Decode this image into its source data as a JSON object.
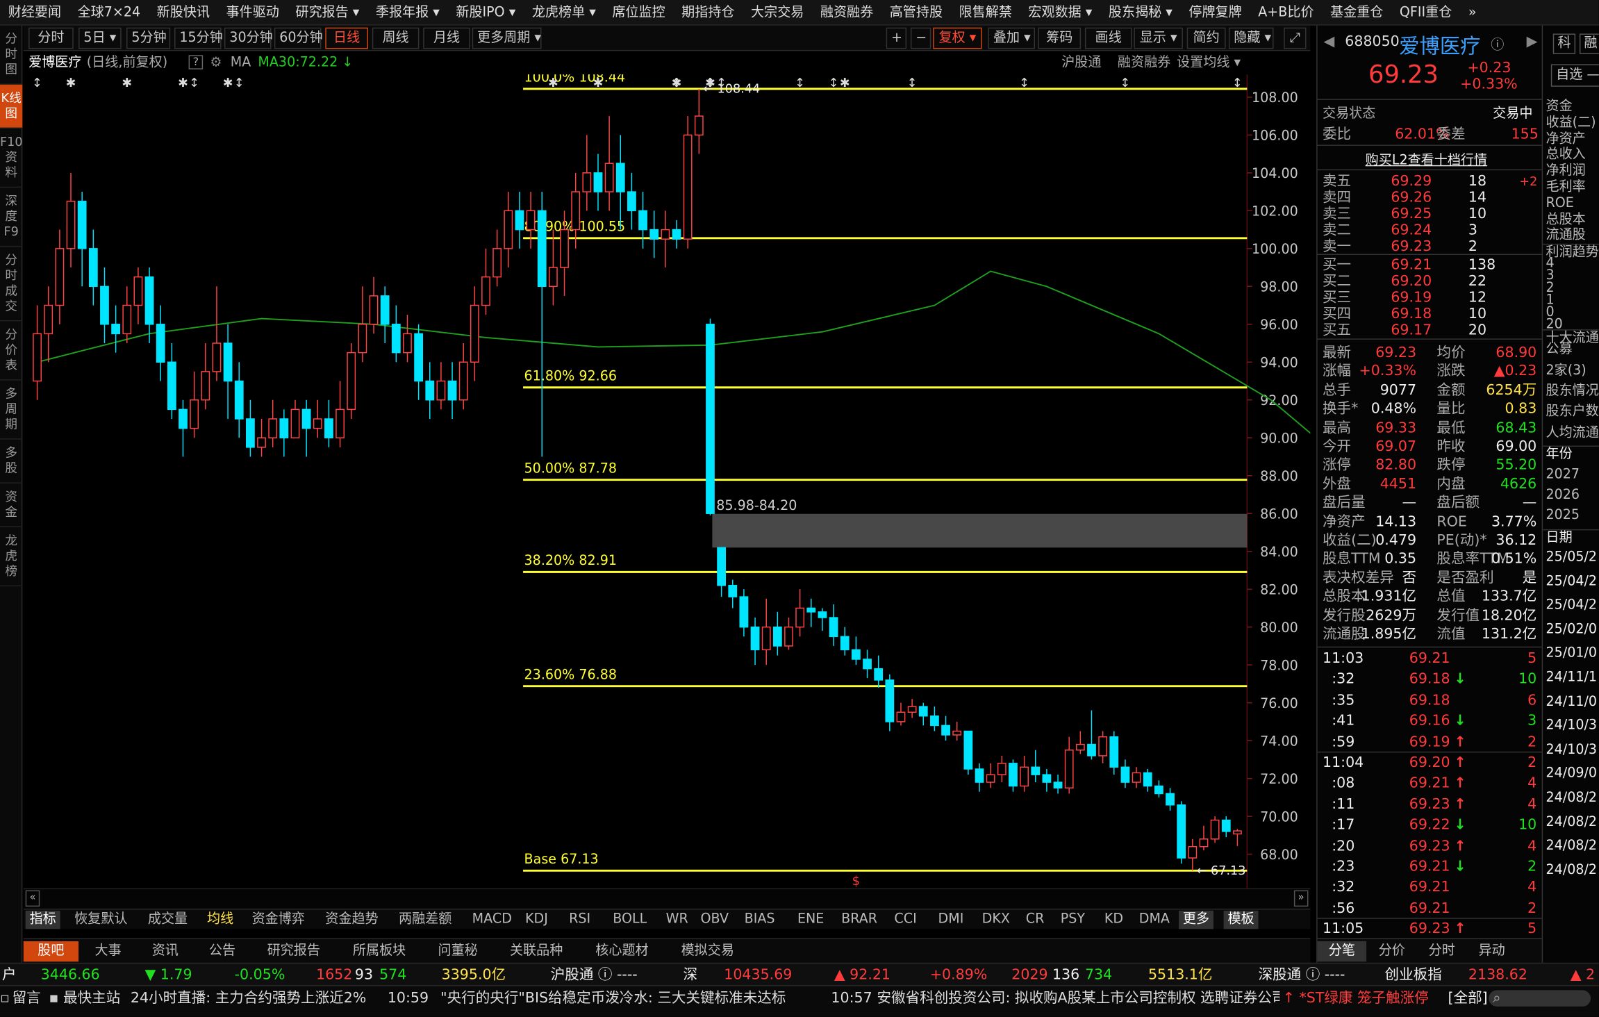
{
  "topnav": [
    "财经要闻",
    "全球7×24",
    "新股快讯",
    "事件驱动",
    "研究报告 ▾",
    "季报年报 ▾",
    "新股IPO ▾",
    "龙虎榜单 ▾",
    "席位监控",
    "期指持仓",
    "大宗交易",
    "融资融券",
    "高管持股",
    "限售解禁",
    "宏观数据 ▾",
    "股东揭秘 ▾",
    "停牌复牌",
    "A+B比价",
    "基金重仓",
    "QFII重仓",
    "»"
  ],
  "leftrail": [
    "分时图",
    "K线图",
    "F10资料",
    "深度F9",
    "分时成交",
    "分价表",
    "多周期",
    "多股",
    "资金",
    "龙虎榜"
  ],
  "periods": [
    "分时",
    "5日 ▾",
    "5分钟",
    "15分钟",
    "30分钟",
    "60分钟",
    "日线",
    "周线",
    "月线",
    "更多周期 ▾"
  ],
  "right_tools": [
    "+",
    "−",
    "复权 ▾",
    "叠加 ▾",
    "筹码",
    "画线",
    "显示 ▾",
    "简约",
    "隐藏 ▾",
    "⤢"
  ],
  "info": {
    "name": "爱博医疗",
    "mode": "(日线,前复权)",
    "q": "?",
    "ma": "MA",
    "ma30": "MA30:72.22 ↓",
    "links": [
      "沪股通",
      "融资融券",
      "设置均线 ▾"
    ]
  },
  "chart_data": {
    "type": "candlestick",
    "title": "爱博医疗 日线 前复权",
    "ylim": [
      66.2,
      109.2
    ],
    "yticks": [
      "108.00",
      "106.00",
      "104.00",
      "102.00",
      "100.00",
      "98.00",
      "96.00",
      "94.00",
      "92.00",
      "90.00",
      "88.00",
      "86.00",
      "84.00",
      "82.00",
      "80.00",
      "78.00",
      "76.00",
      "74.00",
      "72.00",
      "70.00",
      "68.00"
    ],
    "fib": [
      {
        "label": "100.0% 108.44",
        "v": 108.44
      },
      {
        "label": "80.90% 100.55",
        "v": 100.55
      },
      {
        "label": "61.80% 92.66",
        "v": 92.66
      },
      {
        "label": "50.00% 87.78",
        "v": 87.78
      },
      {
        "label": "38.20% 82.91",
        "v": 82.91
      },
      {
        "label": "23.60% 76.88",
        "v": 76.88
      },
      {
        "label": "Base   67.13",
        "v": 67.13
      }
    ],
    "gap": {
      "label": "85.98-84.20",
      "hi": 85.98,
      "lo": 84.2
    },
    "hi_mark": "← 108.44",
    "lo_mark": "← 67.13",
    "ma30": [
      [
        0,
        94
      ],
      [
        10,
        95.5
      ],
      [
        20,
        96.3
      ],
      [
        30,
        96
      ],
      [
        40,
        95.3
      ],
      [
        50,
        94.8
      ],
      [
        60,
        94.9
      ],
      [
        70,
        95.6
      ],
      [
        80,
        97
      ],
      [
        85,
        98.8
      ],
      [
        90,
        98
      ],
      [
        100,
        95.5
      ],
      [
        110,
        92
      ],
      [
        118,
        88
      ],
      [
        125,
        83
      ],
      [
        130,
        79
      ],
      [
        134,
        76
      ],
      [
        140,
        74.5
      ],
      [
        149,
        72.2
      ]
    ],
    "candles": [
      [
        93,
        95.5,
        97,
        92
      ],
      [
        95.5,
        97,
        98,
        94
      ],
      [
        97,
        100,
        101,
        96
      ],
      [
        100,
        102.5,
        104,
        99
      ],
      [
        102.5,
        100,
        103,
        98
      ],
      [
        100,
        98,
        101,
        97
      ],
      [
        98,
        96,
        99,
        95
      ],
      [
        96,
        95.5,
        97,
        94.5
      ],
      [
        95.5,
        97,
        98,
        95
      ],
      [
        97,
        98.5,
        99,
        96
      ],
      [
        98.5,
        96,
        99,
        95
      ],
      [
        96,
        94,
        97,
        93
      ],
      [
        94,
        91.5,
        95,
        91
      ],
      [
        91.5,
        90.5,
        92,
        89
      ],
      [
        90.5,
        92,
        93.5,
        90
      ],
      [
        92,
        93.5,
        95,
        91.5
      ],
      [
        93.5,
        95,
        98,
        93
      ],
      [
        95,
        93,
        96,
        91
      ],
      [
        93,
        91,
        94,
        90
      ],
      [
        91,
        89.5,
        92,
        89
      ],
      [
        89.5,
        90,
        91,
        89
      ],
      [
        90,
        91,
        92,
        89.5
      ],
      [
        91,
        90,
        91.5,
        89
      ],
      [
        90,
        91.5,
        92,
        90
      ],
      [
        91.5,
        90.5,
        92,
        89
      ],
      [
        90.5,
        91,
        92,
        90
      ],
      [
        91,
        90,
        92,
        89.5
      ],
      [
        90,
        91.5,
        93,
        89.5
      ],
      [
        91.5,
        94.5,
        95,
        91
      ],
      [
        94.5,
        96,
        98,
        94
      ],
      [
        96,
        97.5,
        98.5,
        95.5
      ],
      [
        97.5,
        96,
        98,
        95
      ],
      [
        96,
        94.5,
        97,
        94
      ],
      [
        94.5,
        95.5,
        96.5,
        94
      ],
      [
        95.5,
        93,
        96,
        92
      ],
      [
        93,
        92,
        94,
        91
      ],
      [
        92,
        93,
        94,
        91.5
      ],
      [
        93,
        92,
        94,
        91
      ],
      [
        92,
        94,
        95,
        91.5
      ],
      [
        94,
        97,
        98,
        93
      ],
      [
        97,
        98.5,
        100,
        96.5
      ],
      [
        98.5,
        100,
        101,
        98
      ],
      [
        100,
        102,
        103,
        99
      ],
      [
        102,
        101,
        103,
        100
      ],
      [
        101,
        102,
        103,
        100
      ],
      [
        102,
        98,
        103,
        89
      ],
      [
        98,
        99,
        101,
        97
      ],
      [
        99,
        101,
        102,
        97.5
      ],
      [
        101,
        103,
        104,
        100
      ],
      [
        103,
        104,
        106,
        102
      ],
      [
        104,
        103,
        105,
        102
      ],
      [
        103,
        104.5,
        107,
        102
      ],
      [
        104.5,
        103,
        106,
        101
      ],
      [
        103,
        102,
        104,
        101
      ],
      [
        102,
        101,
        103,
        100
      ],
      [
        101,
        100.5,
        102,
        99.5
      ],
      [
        100.5,
        101,
        102,
        99
      ],
      [
        101,
        100.5,
        101.5,
        100
      ],
      [
        100.5,
        106,
        107,
        100
      ],
      [
        106,
        107,
        108.44,
        105
      ],
      [
        96,
        86,
        96.3,
        85.9
      ],
      [
        84.2,
        82.2,
        84.2,
        81.6
      ],
      [
        82.2,
        81.6,
        82.5,
        81
      ],
      [
        81.6,
        80,
        82,
        79.5
      ],
      [
        80,
        78.8,
        80.5,
        78
      ],
      [
        78.8,
        80,
        81.5,
        78
      ],
      [
        80,
        79,
        80.8,
        78.5
      ],
      [
        79,
        80,
        80.5,
        78.8
      ],
      [
        80,
        81,
        82,
        79.5
      ],
      [
        81,
        80.8,
        81.5,
        80
      ],
      [
        80.8,
        80.5,
        81,
        79.8
      ],
      [
        80.5,
        79.5,
        81.2,
        79
      ],
      [
        79.5,
        78.8,
        80,
        78.5
      ],
      [
        78.8,
        78.3,
        79.5,
        78
      ],
      [
        78.3,
        77.8,
        78.8,
        77.3
      ],
      [
        77.8,
        77.2,
        78.5,
        76.8
      ],
      [
        77.2,
        75,
        77.5,
        74.5
      ],
      [
        75,
        75.5,
        76,
        74.8
      ],
      [
        75.5,
        75.8,
        76.2,
        75.2
      ],
      [
        75.8,
        75.3,
        76,
        74.8
      ],
      [
        75.3,
        74.8,
        75.8,
        74.5
      ],
      [
        74.8,
        74.3,
        75.3,
        74
      ],
      [
        74.3,
        74.5,
        75,
        74
      ],
      [
        74.5,
        72.5,
        74.5,
        72.2
      ],
      [
        72.5,
        71.8,
        72.8,
        71.3
      ],
      [
        71.8,
        72.2,
        72.8,
        71.5
      ],
      [
        72.2,
        72.8,
        73.2,
        71.8
      ],
      [
        72.8,
        71.6,
        73,
        71.3
      ],
      [
        71.6,
        72.6,
        73.2,
        71.3
      ],
      [
        72.6,
        72.2,
        73.5,
        71.8
      ],
      [
        72.2,
        71.8,
        72.5,
        71.3
      ],
      [
        71.8,
        71.5,
        72.2,
        71.2
      ],
      [
        71.5,
        73.5,
        74.2,
        71.2
      ],
      [
        73.5,
        73.8,
        74.5,
        73.3
      ],
      [
        73.8,
        73.2,
        75.6,
        73
      ],
      [
        73.2,
        74.2,
        74.5,
        72.8
      ],
      [
        74.2,
        72.6,
        74.5,
        72.2
      ],
      [
        72.6,
        71.8,
        73,
        71.5
      ],
      [
        71.8,
        72.3,
        72.6,
        71.5
      ],
      [
        72.3,
        71.6,
        72.5,
        71.3
      ],
      [
        71.6,
        71.2,
        71.9,
        71
      ],
      [
        71.2,
        70.6,
        71.5,
        70.3
      ],
      [
        70.6,
        67.8,
        70.8,
        67.5
      ],
      [
        67.8,
        68.4,
        68.8,
        67.13
      ],
      [
        68.4,
        68.8,
        69.5,
        68.2
      ],
      [
        68.8,
        69.8,
        70,
        68.6
      ],
      [
        69.8,
        69.2,
        70,
        68.9
      ],
      [
        69.07,
        69.23,
        69.33,
        68.43
      ]
    ]
  },
  "markers": {
    "star": [
      4,
      11,
      18,
      23,
      64,
      69,
      79,
      84,
      100
    ],
    "arrow": [
      0,
      20,
      25,
      79,
      83,
      85,
      94,
      98,
      109,
      122,
      135,
      149
    ]
  },
  "indicators": [
    "指标",
    "恢复默认",
    "成交量",
    "均线",
    "资金博弈",
    "资金趋势",
    "两融差额",
    "MACD",
    "KDJ",
    "RSI",
    "BOLL",
    "WR",
    "OBV",
    "BIAS",
    "ENE",
    "BRAR",
    "CCI",
    "DMI",
    "DKX",
    "CR",
    "PSY",
    "KD",
    "DMA",
    "更多",
    "模板"
  ],
  "bottom_tabs": [
    "股吧",
    "大事",
    "资讯",
    "公告",
    "研究报告",
    "所属板块",
    "问董秘",
    "关联品种",
    "核心题材",
    "模拟交易"
  ],
  "quote": {
    "code": "688050",
    "name": "爱博医疗",
    "price": "69.23",
    "chg": "+0.23",
    "pct": "+0.33%",
    "status_l": "交易状态",
    "status_r": "交易中",
    "webi": "委比",
    "webi_v": "62.01%",
    "wecha": "委差",
    "wecha_v": "155",
    "l2": "购买L2查看十档行情",
    "asks": [
      [
        "卖五",
        "69.29",
        "18",
        "+2"
      ],
      [
        "卖四",
        "69.26",
        "14",
        ""
      ],
      [
        "卖三",
        "69.25",
        "10",
        ""
      ],
      [
        "卖二",
        "69.24",
        "3",
        ""
      ],
      [
        "卖一",
        "69.23",
        "2",
        ""
      ]
    ],
    "bids": [
      [
        "买一",
        "69.21",
        "138"
      ],
      [
        "买二",
        "69.20",
        "22"
      ],
      [
        "买三",
        "69.19",
        "12"
      ],
      [
        "买四",
        "69.18",
        "10"
      ],
      [
        "买五",
        "69.17",
        "20"
      ]
    ],
    "stats": [
      [
        "最新",
        "69.23",
        "r",
        "均价",
        "68.90",
        "r"
      ],
      [
        "涨幅",
        "+0.33%",
        "r",
        "涨跌",
        "▲0.23",
        "r"
      ],
      [
        "总手",
        "9077",
        "w",
        "金额",
        "6254万",
        "y"
      ],
      [
        "换手*",
        "0.48%",
        "w",
        "量比",
        "0.83",
        "y"
      ],
      [
        "最高",
        "69.33",
        "r",
        "最低",
        "68.43",
        "g"
      ],
      [
        "今开",
        "69.07",
        "r",
        "昨收",
        "69.00",
        "w"
      ],
      [
        "涨停",
        "82.80",
        "r",
        "跌停",
        "55.20",
        "g"
      ],
      [
        "外盘",
        "4451",
        "r",
        "内盘",
        "4626",
        "g"
      ],
      [
        "盘后量",
        "—",
        "w",
        "盘后额",
        "—",
        "w"
      ],
      [
        "净资产",
        "14.13",
        "w",
        "ROE",
        "3.77%",
        "w"
      ],
      [
        "收益(二)",
        "0.479",
        "w",
        "PE(动)*",
        "36.12",
        "w"
      ],
      [
        "股息TTM",
        "0.35",
        "w",
        "股息率TTM",
        "0.51%",
        "w"
      ],
      [
        "表决权差异",
        "否",
        "w",
        "是否盈利",
        "是",
        "w"
      ],
      [
        "总股本",
        "1.931亿",
        "w",
        "总值",
        "133.7亿",
        "w"
      ],
      [
        "发行股",
        "2629万",
        "w",
        "发行值",
        "18.20亿",
        "w"
      ],
      [
        "流通股",
        "1.895亿",
        "w",
        "流值",
        "131.2亿",
        "w"
      ]
    ],
    "ticks_t1": "11:03",
    "ticks1": [
      [
        "",
        "69.21",
        "",
        "5"
      ],
      [
        ":32",
        "69.18",
        "↓",
        "10"
      ],
      [
        ":35",
        "69.18",
        "",
        "6"
      ],
      [
        ":41",
        "69.16",
        "↓",
        "3"
      ],
      [
        ":59",
        "69.19",
        "↑",
        "2"
      ]
    ],
    "ticks_t2": "11:04",
    "ticks2": [
      [
        "",
        "69.20",
        "↑",
        "2"
      ],
      [
        ":08",
        "69.21",
        "↑",
        "4"
      ],
      [
        ":11",
        "69.23",
        "↑",
        "4"
      ],
      [
        ":17",
        "69.22",
        "↓",
        "10"
      ],
      [
        ":20",
        "69.23",
        "↑",
        "4"
      ],
      [
        ":23",
        "69.21",
        "↓",
        "2"
      ],
      [
        ":32",
        "69.21",
        "",
        "4"
      ],
      [
        ":56",
        "69.21",
        "",
        "2"
      ]
    ],
    "ticks_t3": "11:05",
    "ticks3": [
      [
        "",
        "69.23",
        "↑",
        "5"
      ]
    ],
    "tabs": [
      "分笔",
      "分价",
      "分时",
      "异动"
    ]
  },
  "far": {
    "btns": [
      "科",
      "融"
    ],
    "zixuan": "自选 —",
    "lines": [
      "资金",
      "收益(二)",
      "净资产",
      "总收入",
      "净利润",
      "毛利率",
      "ROE",
      "总股本",
      "流通股",
      "利润趋势",
      "4",
      "3",
      "2",
      "1",
      "0",
      "20",
      "十大流通股",
      "公募",
      "2家(3)",
      "股东情况",
      "股东户数",
      "人均流通",
      "年份",
      "2027",
      "2026",
      "2025",
      "日期",
      "25/05/2",
      "25/04/2",
      "25/04/2",
      "25/02/0",
      "25/01/0",
      "24/11/1",
      "24/11/0",
      "24/10/3",
      "24/10/3",
      "24/09/0",
      "24/08/2",
      "24/08/2",
      "24/08/2",
      "24/08/2"
    ]
  },
  "index": {
    "sh": "户",
    "sh_v": "3446.66",
    "sh_c": "▼ 1.79",
    "sh_p": "-0.05%",
    "sh_u": "1652",
    "sh_f": "93",
    "sh_d": "574",
    "sh_a": "3395.0亿",
    "hgt": "沪股通 ⓘ ----",
    "sz": "深",
    "sz_v": "10435.69",
    "sz_c": "▲ 92.21",
    "sz_p": "+0.89%",
    "sz_u": "2029",
    "sz_f": "136",
    "sz_d": "734",
    "sz_a": "5513.1亿",
    "sgt": "深股通 ⓘ ----",
    "cy": "创业板指",
    "cy_v": "2138.62",
    "cy_c": "▲ 2"
  },
  "news": {
    "a": "留言",
    "b": "最快主站",
    "c": "24小时直播: 主力合约强势上涨近2%",
    "t1": "10:59",
    "n1": "\"央行的央行\"BIS给稳定币泼冷水: 三大关键标准未达标",
    "t2": "10:57",
    "n2": "安徽省科创投资公司: 拟收购A股某上市公司控制权 选聘证券公司",
    "hot": "↑ *ST绿康 笼子触涨停",
    "all": "[全部]"
  }
}
